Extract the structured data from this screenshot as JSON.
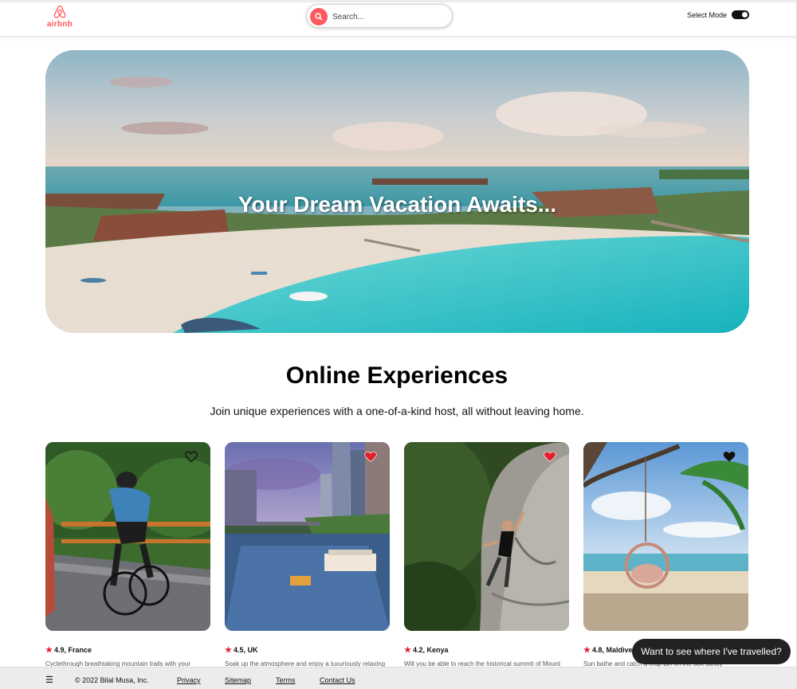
{
  "header": {
    "logo_text": "airbnb",
    "search_placeholder": "Search...",
    "mode_label": "Select Mode"
  },
  "hero": {
    "title": "Your Dream Vacation Awaits..."
  },
  "section": {
    "title": "Online Experiences",
    "subtitle": "Join unique experiences with a one-of-a-kind host, all without leaving home."
  },
  "cards": [
    {
      "rating": "4.9, France",
      "description": "Cyclethrough breathtaking mountain trails with your",
      "favorited": false,
      "heart_color": "#111111"
    },
    {
      "rating": "4.5, UK",
      "description": "Soak up the atmosphere and enjoy a luxuriously relaxing",
      "favorited": true,
      "heart_color": "#e0202c"
    },
    {
      "rating": "4.2, Kenya",
      "description": "Will you be able to reach the historical summit of Mount",
      "favorited": true,
      "heart_color": "#e0202c"
    },
    {
      "rating": "4.8, Maldive",
      "description": "Sun bathe and catch a crap tan on the soft sandy",
      "favorited": false,
      "heart_color": "#111111"
    }
  ],
  "chat_bubble": "Want to see where I've travelled?",
  "footer": {
    "menu_icon": "☰",
    "copyright": "© 2022 Bilal Musa, Inc.",
    "links": [
      "Privacy",
      "Sitemap",
      "Terms",
      "Contact Us"
    ]
  },
  "colors": {
    "brand": "#ff5a5f",
    "heart_active": "#e0202c"
  }
}
